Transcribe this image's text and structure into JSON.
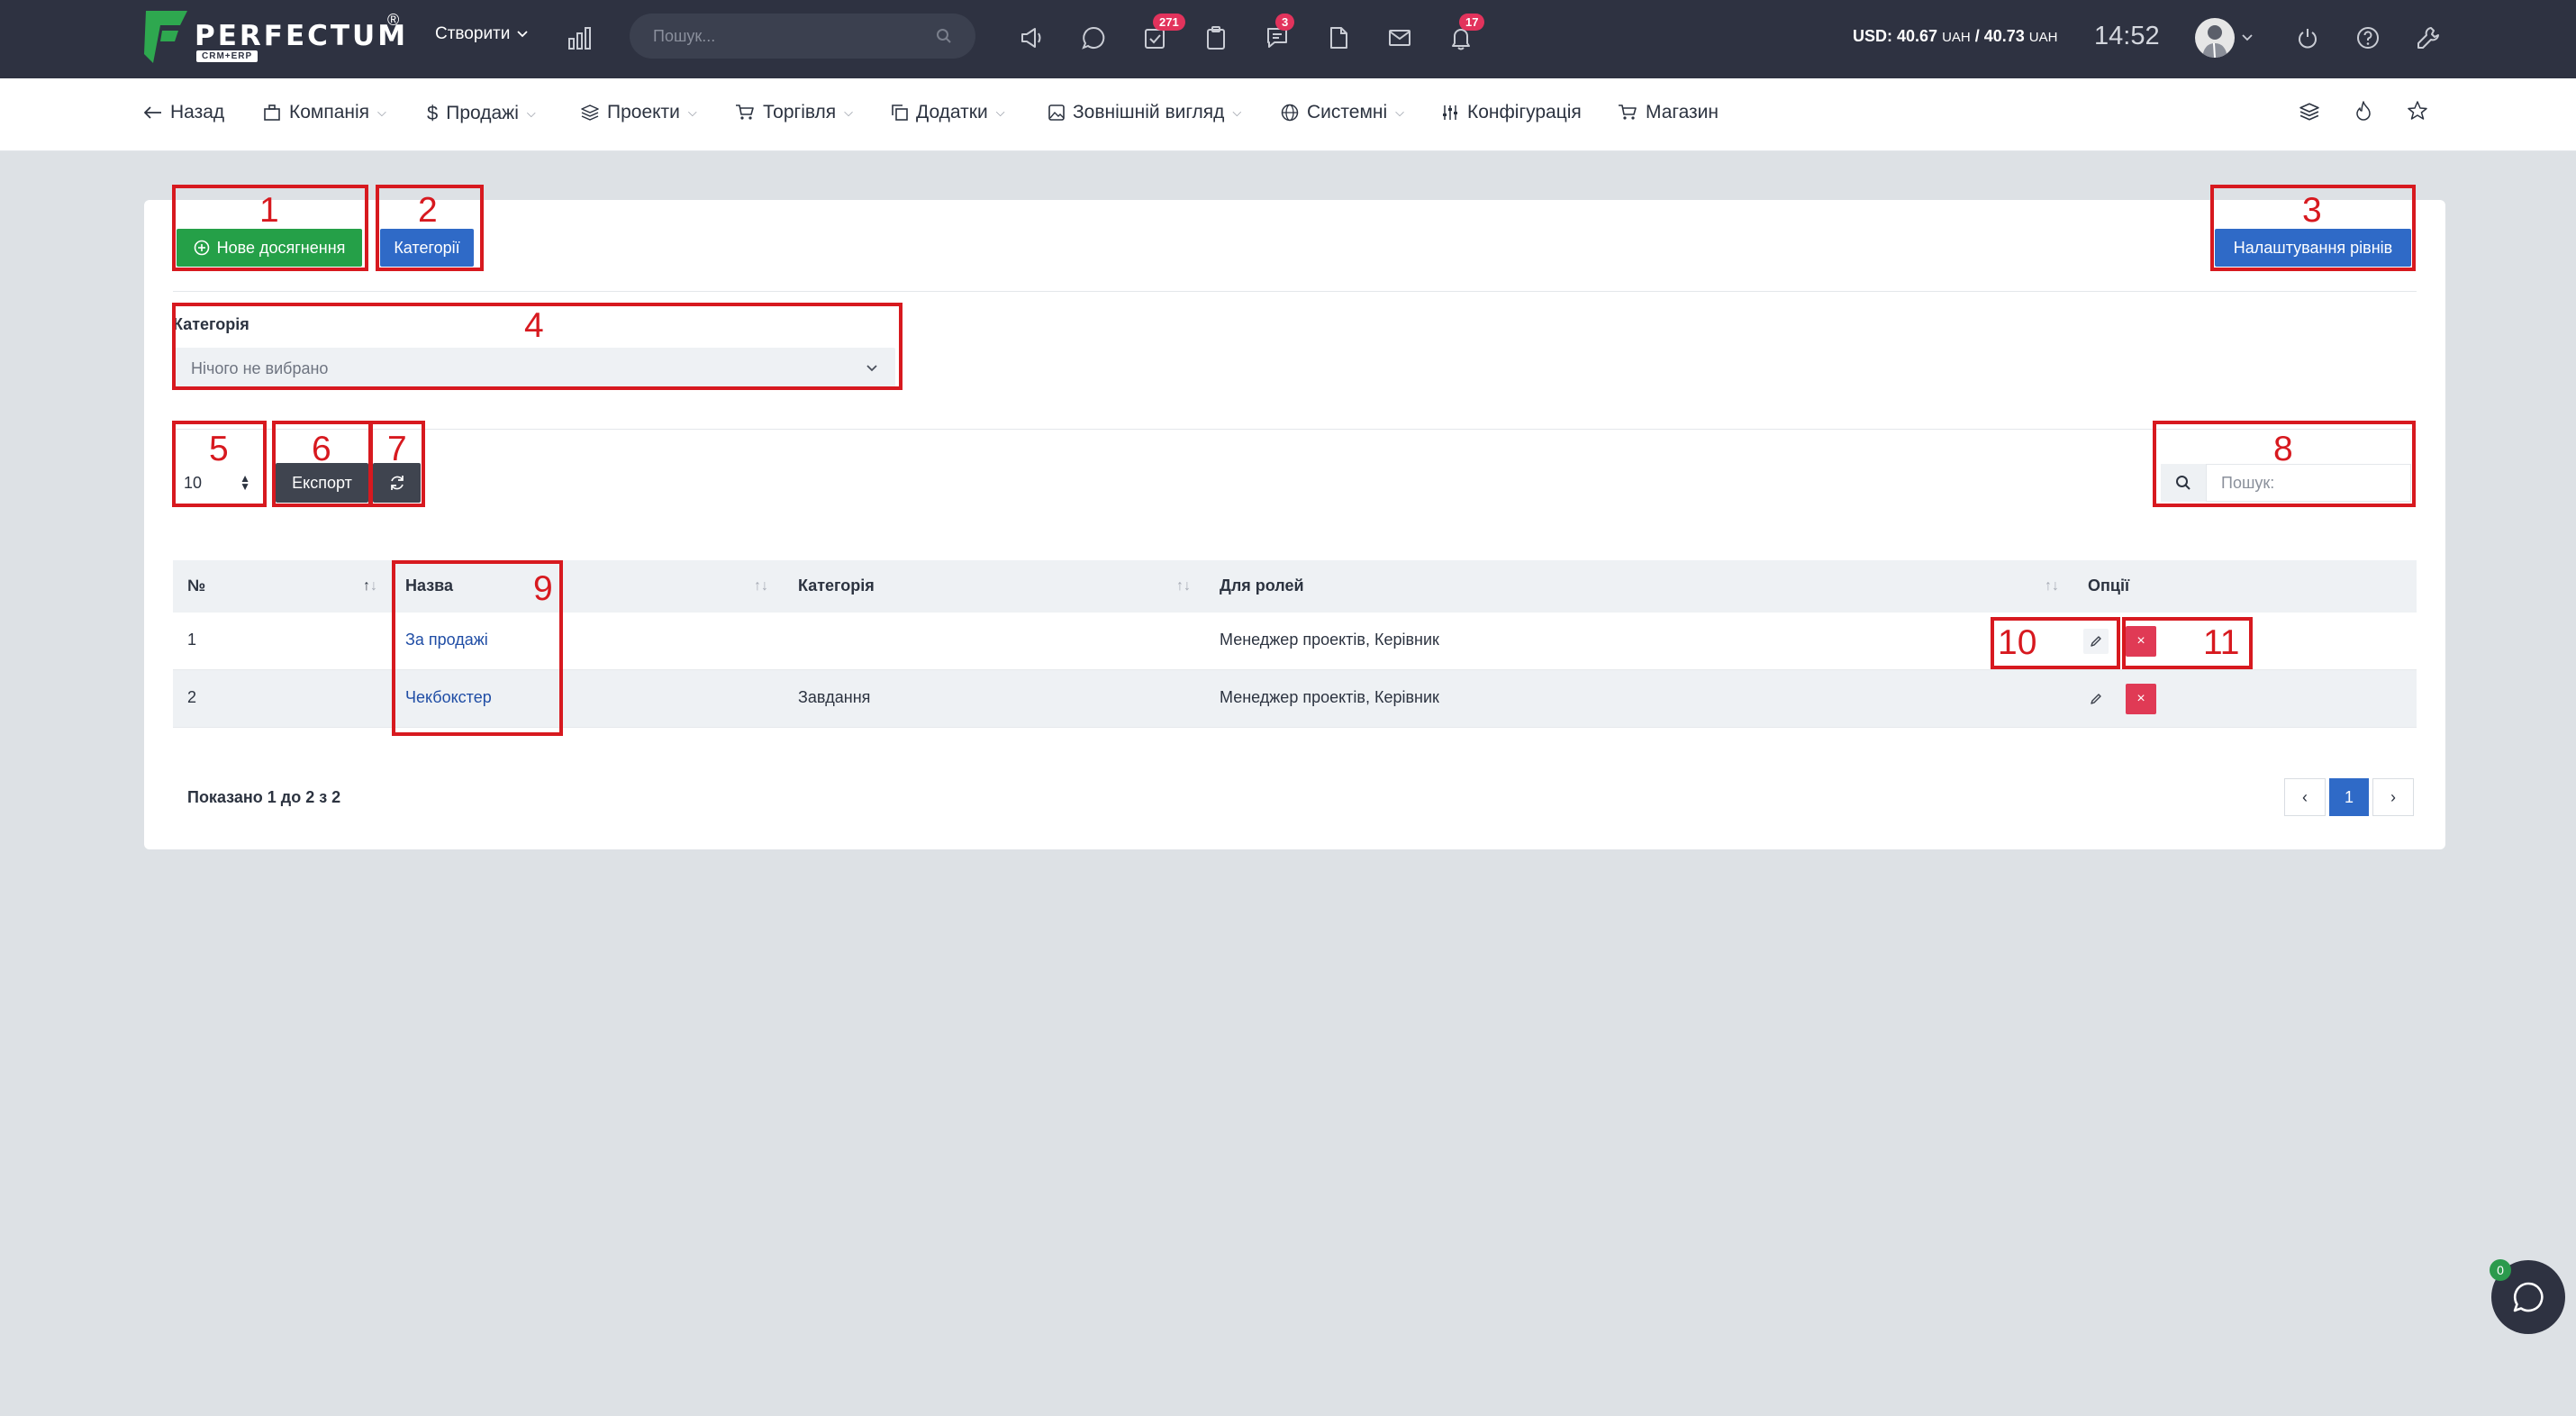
{
  "topbar": {
    "brand": "PERFECTUM",
    "brand_sub": "CRM+ERP",
    "brand_reg": "®",
    "create_label": "Створити",
    "search_placeholder": "Пошук...",
    "badges": {
      "tasks": "271",
      "chats": "3",
      "notifications": "17"
    },
    "currency_usd": "USD: 40.67",
    "currency_uah1": "UAH",
    "currency_sep": " / 40.73",
    "currency_uah2": "UAH",
    "time": "14:52"
  },
  "nav": {
    "back": "Назад",
    "company": "Компанія",
    "sales": "Продажі",
    "projects": "Проекти",
    "trade": "Торгівля",
    "addons": "Додатки",
    "appearance": "Зовнішній вигляд",
    "system": "Системні",
    "config": "Конфігурація",
    "shop": "Магазин"
  },
  "toolbar": {
    "new_achievement": "Нове досягнення",
    "categories": "Категорії",
    "level_settings": "Налаштування рівнів"
  },
  "filter": {
    "label": "Категорія",
    "value": "Нічого не вибрано"
  },
  "table_controls": {
    "page_length": "10",
    "export": "Експорт",
    "search_placeholder": "Пошук:"
  },
  "table": {
    "headers": [
      "№",
      "Назва",
      "Категорія",
      "Для ролей",
      "Опції"
    ],
    "rows": [
      {
        "num": "1",
        "name": "За продажі",
        "category": "",
        "roles": "Менеджер проектів, Керівник"
      },
      {
        "num": "2",
        "name": "Чекбокстер",
        "category": "Завдання",
        "roles": "Менеджер проектів, Керівник"
      }
    ],
    "info": "Показано 1 до 2 з 2",
    "pagination": {
      "prev": "‹",
      "current": "1",
      "next": "›"
    }
  },
  "annotations": [
    "1",
    "2",
    "3",
    "4",
    "5",
    "6",
    "7",
    "8",
    "9",
    "10",
    "11"
  ],
  "chat": {
    "badge": "0"
  },
  "colors": {
    "topbar": "#2e3241",
    "green": "#25a048",
    "blue": "#2f6ac7",
    "dark": "#3f444f",
    "danger": "#e03a55",
    "annotation": "#d7191f",
    "link": "#1f4da5"
  }
}
